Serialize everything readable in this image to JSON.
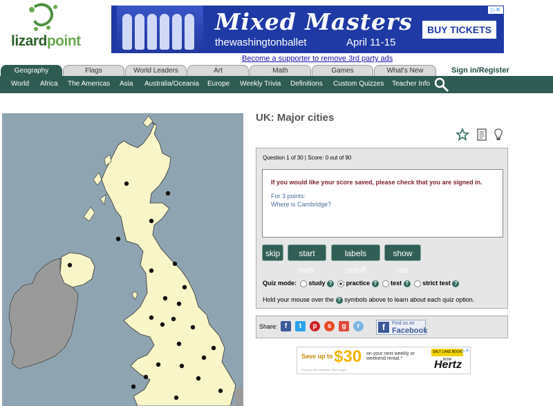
{
  "logo": {
    "part1": "lizard",
    "part2": "point"
  },
  "top_ad": {
    "title": "Mixed Masters",
    "subtitle": "thewashingtonballet",
    "date": "April 11-15",
    "cta": "BUY TICKETS"
  },
  "supporter_link": "Become a supporter to remove 3rd party ads",
  "tabs": [
    "Geography",
    "Flags",
    "World Leaders",
    "Art",
    "Math",
    "Games",
    "What's New"
  ],
  "signin": "Sign in/Register",
  "nav": [
    "World",
    "Africa",
    "The Americas",
    "Asia",
    "Australia/Oceania",
    "Europe",
    "Weekly Trivia",
    "Definitions",
    "Custom Quizzes",
    "Teacher Info"
  ],
  "page_title": "UK: Major cities",
  "quiz": {
    "meta": "Question 1 of 30 | Score: 0 out of 90",
    "signed_msg": "If you would like your score saved, please check that you are signed in.",
    "points": "For 3 points:",
    "question": "Where is Cambridge?",
    "buttons": [
      "skip",
      "start over",
      "labels on/off",
      "show me"
    ],
    "mode_label": "Quiz mode:",
    "modes": [
      {
        "label": "study",
        "selected": false
      },
      {
        "label": "practice",
        "selected": true
      },
      {
        "label": "test",
        "selected": false
      },
      {
        "label": "strict test",
        "selected": false
      }
    ],
    "hold_pre": "Hold your mouse over the",
    "hold_post": "symbols above to learn about each quiz option."
  },
  "share": {
    "label": "Share:",
    "fb_small": "Find us on",
    "fb_big": "Facebook"
  },
  "hertz_ad": {
    "save_text": "Save up to",
    "amount": "$30",
    "detail": "on your next weekly or weekend rental.*",
    "fine": "*Taxes & fees excluded. Terms apply.",
    "badge": "SALT LAKE BOOK NOW",
    "brand": "Hertz"
  },
  "colors": {
    "nav_green": "#2f5c52",
    "land": "#f8f5c8",
    "sea": "#8fa4b1",
    "ireland": "#9a9a9a"
  }
}
